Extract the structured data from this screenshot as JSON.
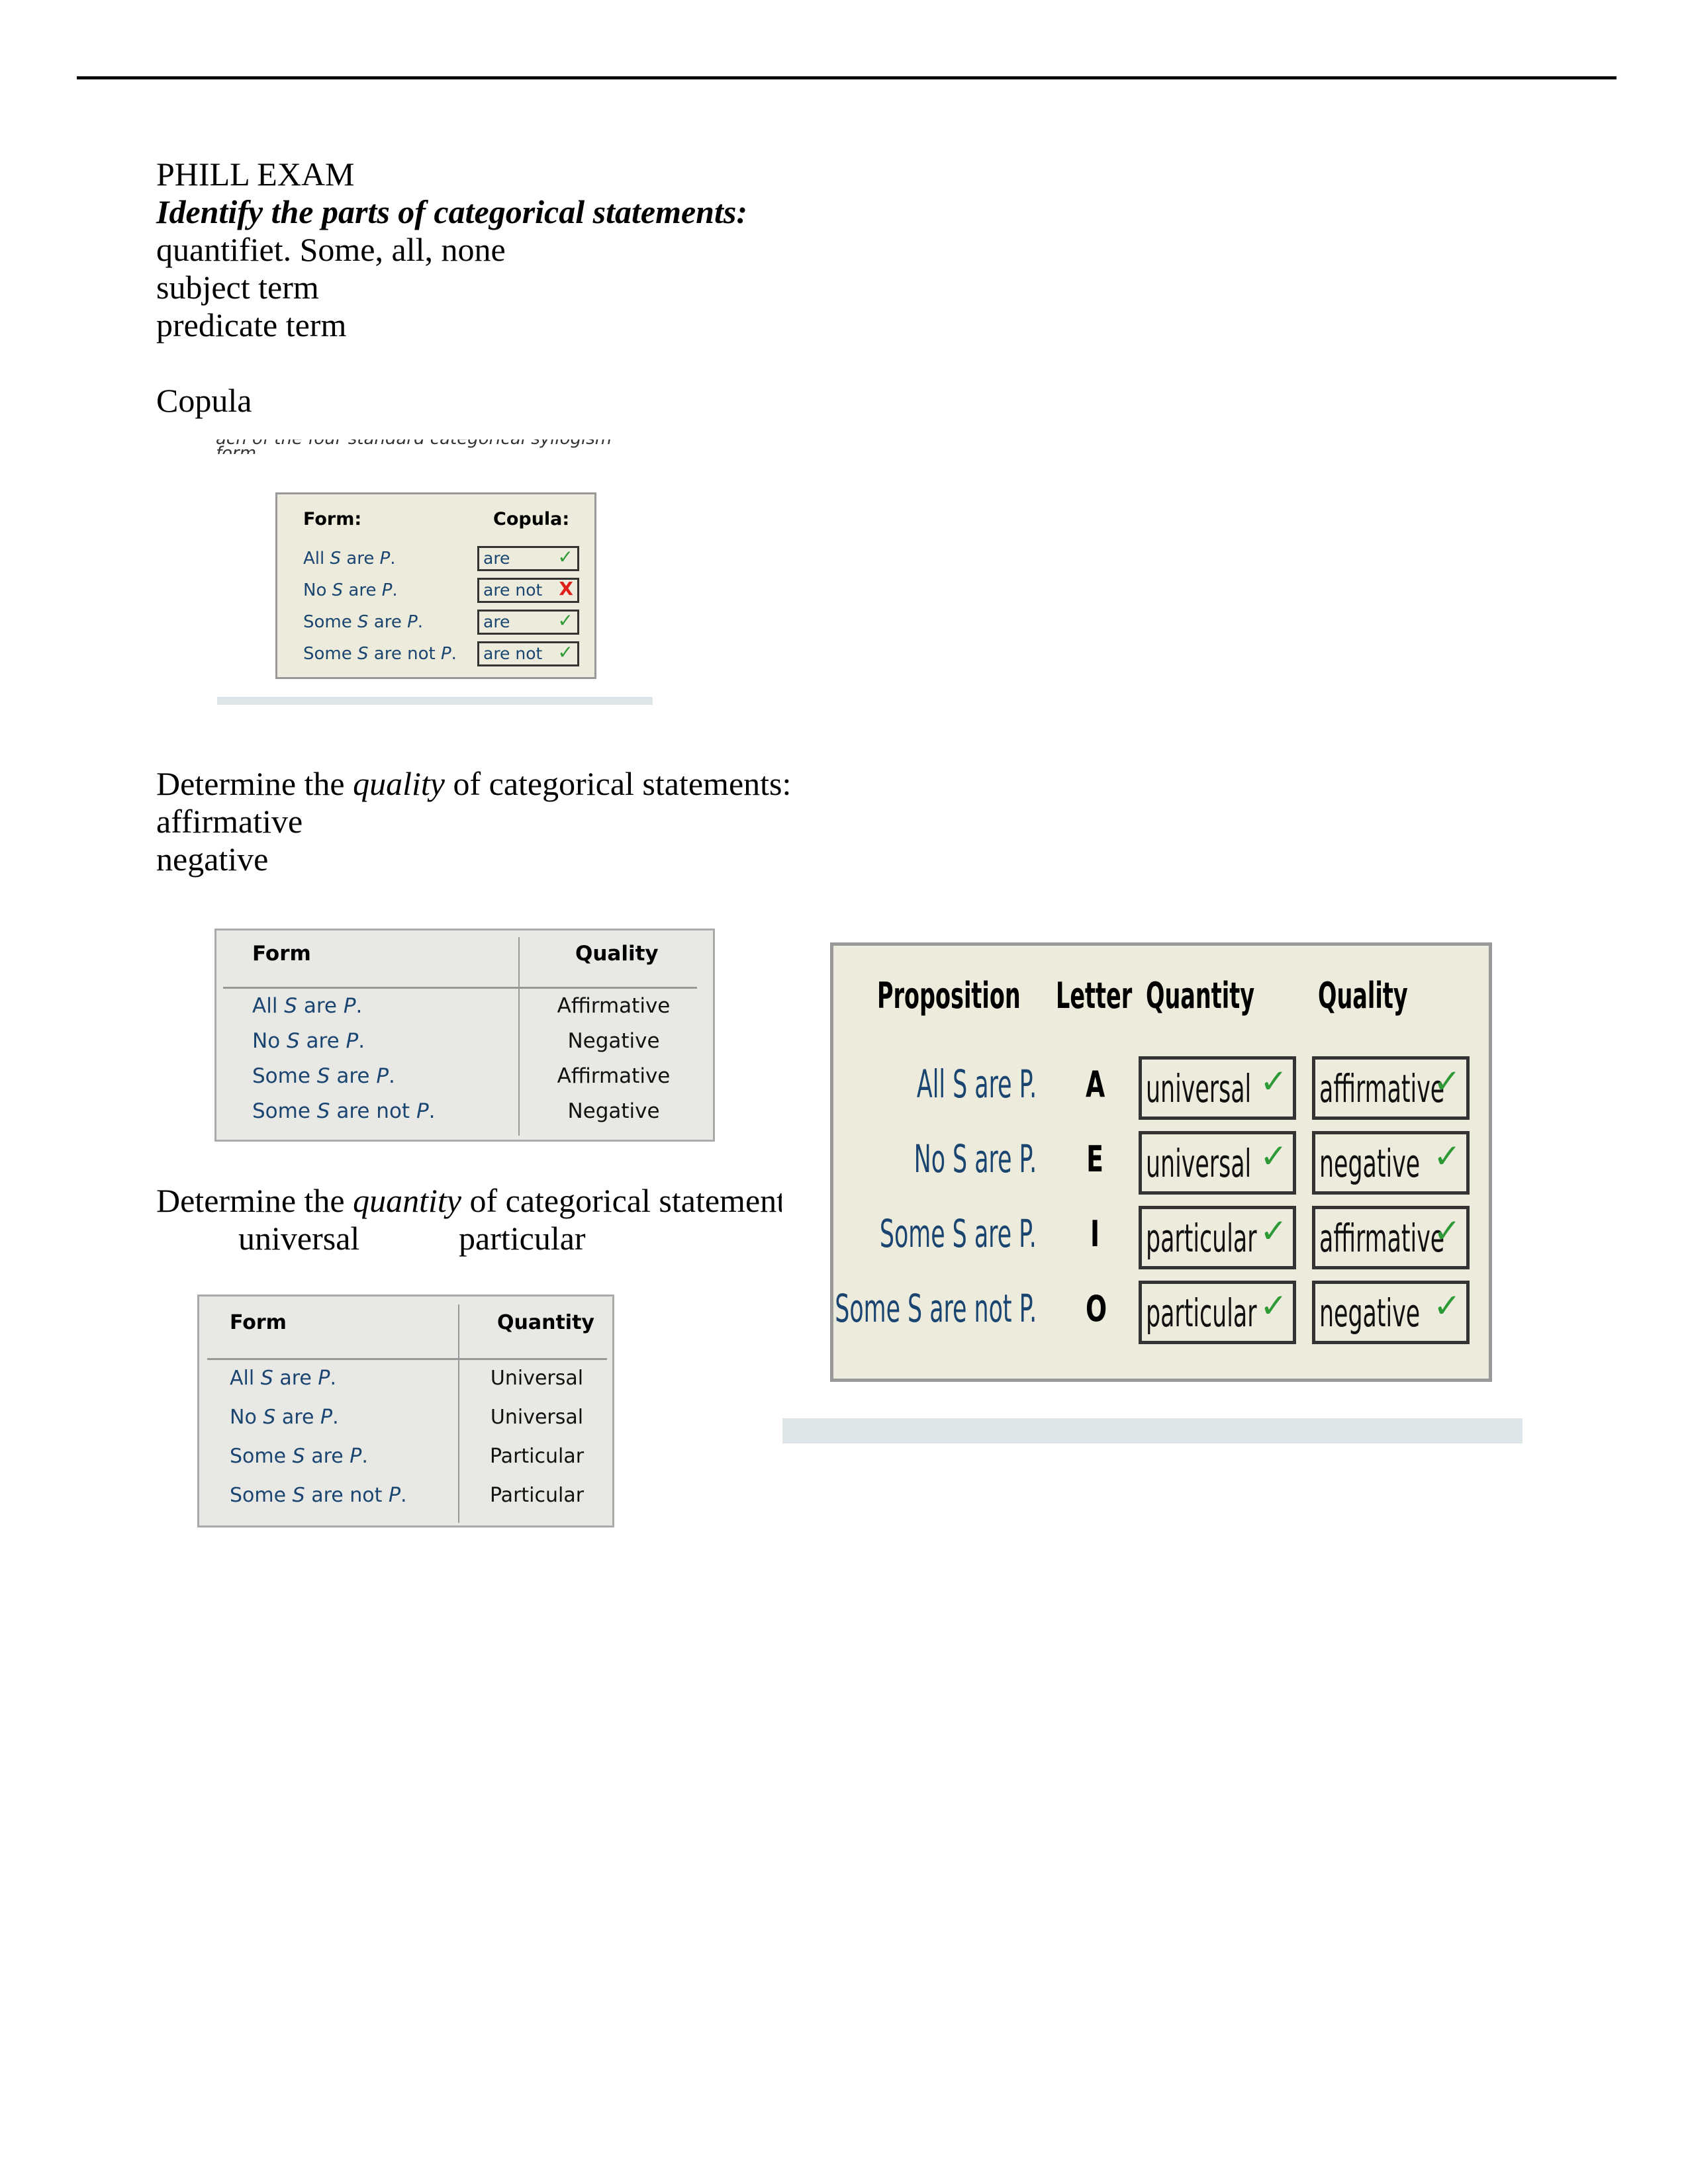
{
  "document": {
    "title": "PHILL EXAM",
    "section1": {
      "heading": "Identify the parts of categorical statements:",
      "lines": [
        "quantifiet. Some, all, none",
        "subject term",
        "predicate term"
      ],
      "copula_label": "Copula"
    },
    "cropped_caption": "ach of the four standard categorical syllogism form."
  },
  "copula_table": {
    "headers": {
      "form": "Form:",
      "copula": "Copula:"
    },
    "rows": [
      {
        "form_parts": [
          "All ",
          "S",
          " are ",
          "P",
          "."
        ],
        "answer": "are",
        "status": "correct",
        "mark": "✓"
      },
      {
        "form_parts": [
          "No ",
          "S",
          " are ",
          "P",
          "."
        ],
        "answer": "are not",
        "status": "incorrect",
        "mark": "X"
      },
      {
        "form_parts": [
          "Some ",
          "S",
          " are ",
          "P",
          "."
        ],
        "answer": "are",
        "status": "correct",
        "mark": "✓"
      },
      {
        "form_parts": [
          "Some ",
          "S",
          " are not ",
          "P",
          "."
        ],
        "answer": "are not",
        "status": "correct",
        "mark": "✓"
      }
    ]
  },
  "section2": {
    "heading_pre": "Determine the ",
    "heading_em": "quality",
    "heading_post": " of categorical statements:",
    "lines": [
      "affirmative",
      "negative"
    ]
  },
  "quality_table": {
    "headers": {
      "form": "Form",
      "value": "Quality"
    },
    "rows": [
      {
        "form_parts": [
          "All ",
          "S",
          " are ",
          "P",
          "."
        ],
        "value": "Affirmative"
      },
      {
        "form_parts": [
          "No ",
          "S",
          " are ",
          "P",
          "."
        ],
        "value": "Negative"
      },
      {
        "form_parts": [
          "Some ",
          "S",
          " are ",
          "P",
          "."
        ],
        "value": "Affirmative"
      },
      {
        "form_parts": [
          "Some ",
          "S",
          " are not ",
          "P",
          "."
        ],
        "value": "Negative"
      }
    ]
  },
  "section3": {
    "heading_pre": "Determine the ",
    "heading_em": "quantity",
    "heading_post": " of categorical statement",
    "option_a": "universal",
    "option_b": "particular"
  },
  "quantity_table": {
    "headers": {
      "form": "Form",
      "value": "Quantity"
    },
    "rows": [
      {
        "form_parts": [
          "All ",
          "S",
          " are ",
          "P",
          "."
        ],
        "value": "Universal"
      },
      {
        "form_parts": [
          "No ",
          "S",
          " are ",
          "P",
          "."
        ],
        "value": "Universal"
      },
      {
        "form_parts": [
          "Some ",
          "S",
          " are ",
          "P",
          "."
        ],
        "value": "Particular"
      },
      {
        "form_parts": [
          "Some ",
          "S",
          " are not ",
          "P",
          "."
        ],
        "value": "Particular"
      }
    ]
  },
  "proposition_table": {
    "headers": {
      "proposition": "Proposition",
      "letter": "Letter",
      "quantity": "Quantity",
      "quality": "Quality"
    },
    "rows": [
      {
        "proposition": "All S are P.",
        "letter": "A",
        "quantity": "universal",
        "quality": "affirmative",
        "quantity_mark": "✓",
        "quality_mark": "✓"
      },
      {
        "proposition": "No S are P.",
        "letter": "E",
        "quantity": "universal",
        "quality": "negative",
        "quantity_mark": "✓",
        "quality_mark": "✓"
      },
      {
        "proposition": "Some S are P.",
        "letter": "I",
        "quantity": "particular",
        "quality": "affirmative",
        "quantity_mark": "✓",
        "quality_mark": "✓"
      },
      {
        "proposition": "Some S are not P.",
        "letter": "O",
        "quantity": "particular",
        "quality": "negative",
        "quantity_mark": "✓",
        "quality_mark": "✓"
      }
    ]
  },
  "colors": {
    "form_text": "#1b4571",
    "correct": "#2e9a36",
    "incorrect": "#e0211b",
    "panel_bg": "#ecebdc",
    "grey_panel_bg": "#e8e8e5"
  }
}
